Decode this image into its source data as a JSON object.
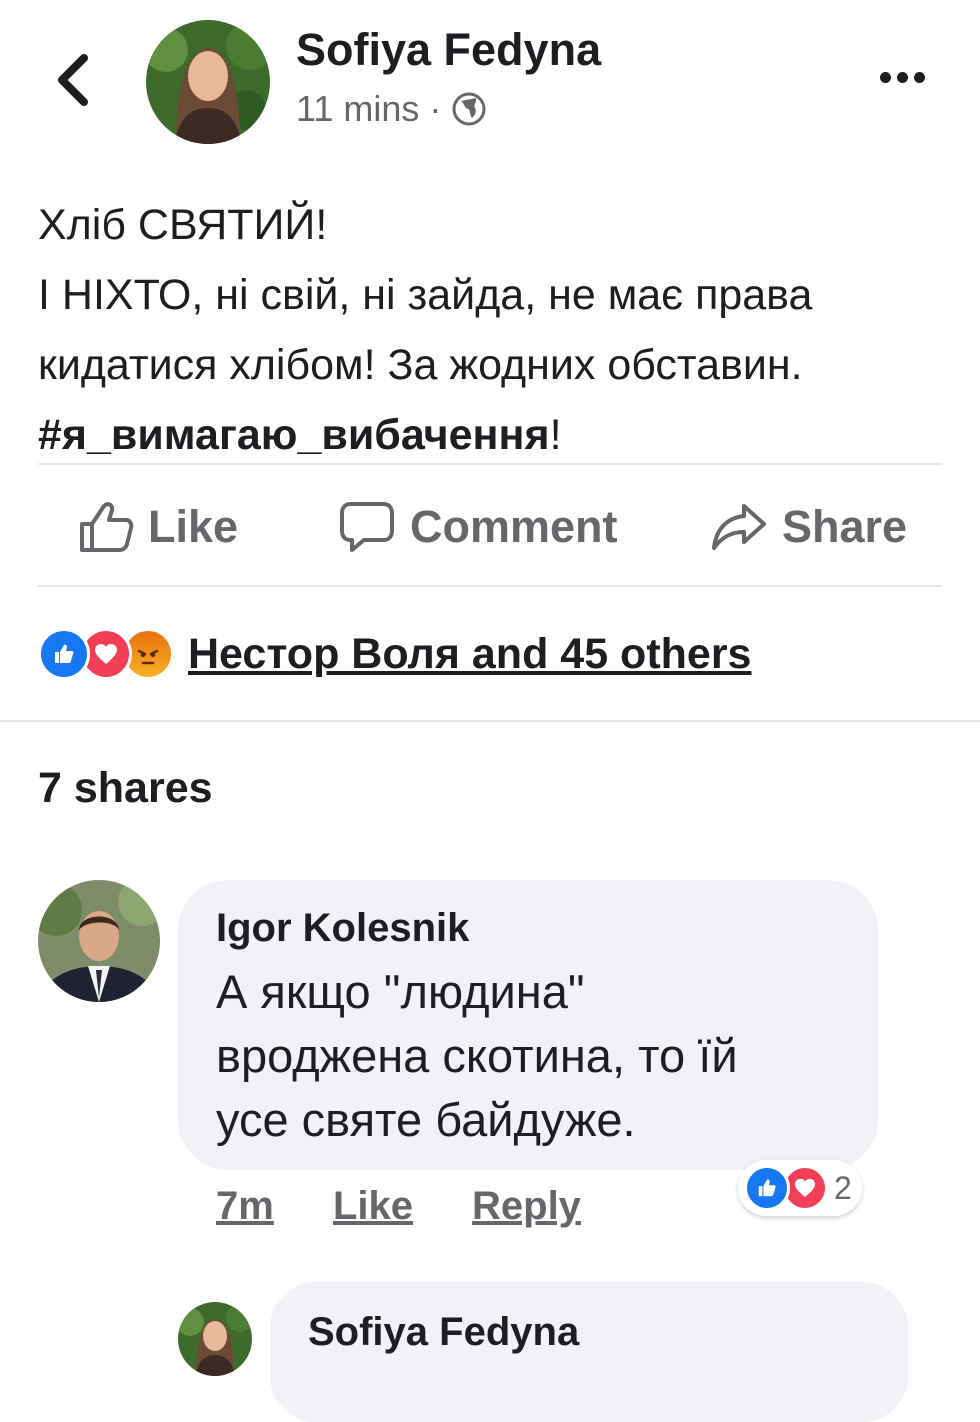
{
  "post": {
    "author": "Sofiya Fedyna",
    "time": "11 mins",
    "separator": "·",
    "privacy_icon": "globe-icon",
    "text_lines": [
      "Хліб СВЯТИЙ!",
      "І НІХТО, ні свій, ні зайда, не має права",
      "кидатися хлібом! За жодних обставин."
    ],
    "hashtag": "#я_вимагаю_вибачення",
    "hashtag_suffix": "!"
  },
  "actions": {
    "like": "Like",
    "comment": "Comment",
    "share": "Share"
  },
  "reactions": {
    "icons": [
      "like-reaction-icon",
      "love-reaction-icon",
      "angry-reaction-icon"
    ],
    "summary": "Нестор Воля and 45 others"
  },
  "shares": "7 shares",
  "comments": [
    {
      "author": "Igor Kolesnik",
      "text_lines": [
        "А якщо \"людина\"",
        "вроджена скотина, то їй",
        "усе святе байдуже."
      ],
      "time": "7m",
      "like_label": "Like",
      "reply_label": "Reply",
      "reaction_icons": [
        "like-reaction-icon",
        "love-reaction-icon"
      ],
      "reaction_count": "2"
    }
  ],
  "reply": {
    "author": "Sofiya Fedyna"
  },
  "colors": {
    "text": "#1c1e21",
    "secondary": "#65676b",
    "bubble": "#f0f2f5",
    "like_blue": "#1877f2",
    "love_red": "#f33e58",
    "angry_orange": "#e9710f"
  }
}
